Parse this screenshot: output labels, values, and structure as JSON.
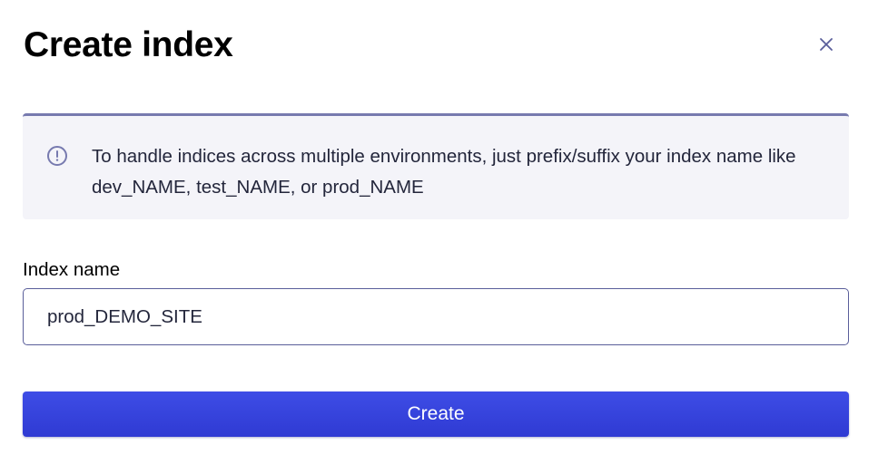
{
  "dialog": {
    "title": "Create index",
    "close_icon": "close-icon"
  },
  "callout": {
    "icon": "info-circle-icon",
    "message": "To handle indices across multiple environments, just prefix/suffix your index name like dev_NAME, test_NAME, or prod_NAME"
  },
  "form": {
    "index_name_label": "Index name",
    "index_name_value": "prod_DEMO_SITE",
    "submit_label": "Create"
  },
  "colors": {
    "accent": "#3a45e0",
    "callout_border": "#777aaf",
    "callout_bg": "#f4f4f9",
    "close_icon": "#5a5e9a"
  }
}
